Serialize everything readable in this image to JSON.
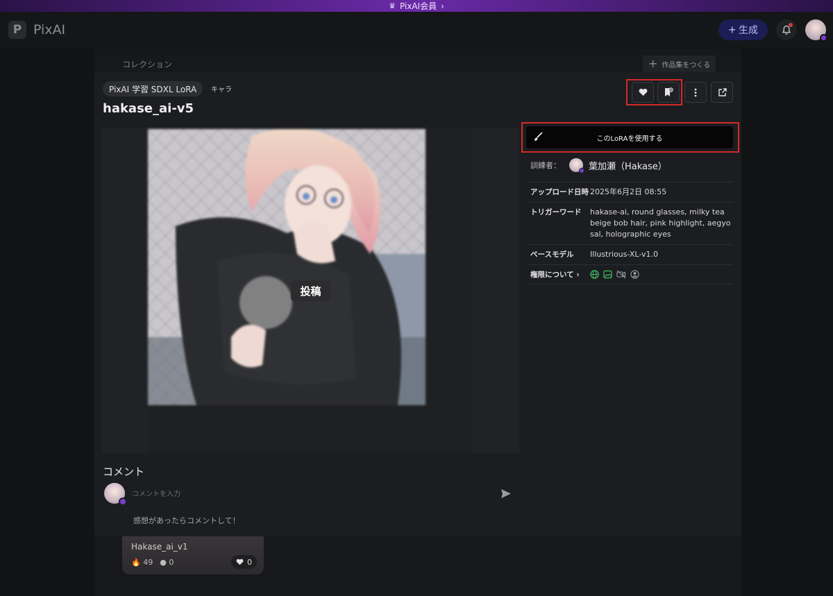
{
  "banner": {
    "text": "PixAI会員",
    "crown_icon": "crown-icon",
    "chevron": "›"
  },
  "header": {
    "logo_letter": "P",
    "logo_text": "PixAI",
    "generate_label": "生成",
    "generate_plus": "+"
  },
  "collection": {
    "label": "コレクション",
    "create_label": "作品集をつくる"
  },
  "model": {
    "tag": "PixAI 学習 SDXL LoRA",
    "category": "キャラ",
    "title": "hakase_ai-v5",
    "post_label": "投稿"
  },
  "actions": {
    "use_lora_label": "このLoRAを使用する"
  },
  "trainer": {
    "label": "訓練者：",
    "name": "葉加瀬（Hakase）"
  },
  "info": {
    "upload_key": "アップロード日時",
    "upload_value": "2025年6月2日 08:55",
    "trigger_key": "トリガーワード",
    "trigger_value": "hakase-ai, round glasses, milky tea beige bob hair, pink highlight, aegyo sal, holographic eyes",
    "base_key": "ベースモデル",
    "base_value": "Illustrious-XL-v1.0",
    "perm_key": "権限について ›"
  },
  "comments": {
    "title": "コメント",
    "placeholder": "コメントを入力",
    "hint": "感想があったらコメントして！"
  },
  "card": {
    "name": "Hakase_ai_v1",
    "fires": "49",
    "comments": "0",
    "likes": "0"
  },
  "colors": {
    "accent_red": "#d42a2a",
    "generate_bg": "#1c1d55",
    "premium_purple": "#7a3bd1"
  }
}
